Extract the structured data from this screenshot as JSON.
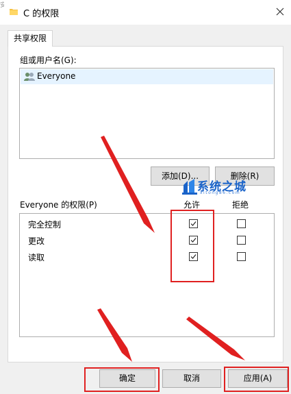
{
  "window": {
    "title": "C 的权限",
    "title_left_sliver": "安",
    "folder_icon": "folder-icon",
    "close_icon": "close-icon"
  },
  "tabs": [
    {
      "label": "共享权限",
      "selected": true
    }
  ],
  "groups": {
    "label": "组或用户名(G):",
    "items": [
      {
        "name": "Everyone",
        "icon": "users-icon",
        "selected": true
      }
    ]
  },
  "buttons": {
    "add": "添加(D)...",
    "remove": "删除(R)",
    "ok": "确定",
    "cancel": "取消",
    "apply": "应用(A)"
  },
  "watermark": {
    "text": "系统之城",
    "url": "xitong86.com"
  },
  "permissions": {
    "title": "Everyone 的权限(P)",
    "allow_header": "允许",
    "deny_header": "拒绝",
    "rows": [
      {
        "name": "完全控制",
        "allow": true,
        "deny": false
      },
      {
        "name": "更改",
        "allow": true,
        "deny": false
      },
      {
        "name": "读取",
        "allow": true,
        "deny": false
      }
    ]
  },
  "colors": {
    "annotation": "#e02020",
    "selection": "#e5f3ff",
    "watermark": "#1a63c9"
  }
}
